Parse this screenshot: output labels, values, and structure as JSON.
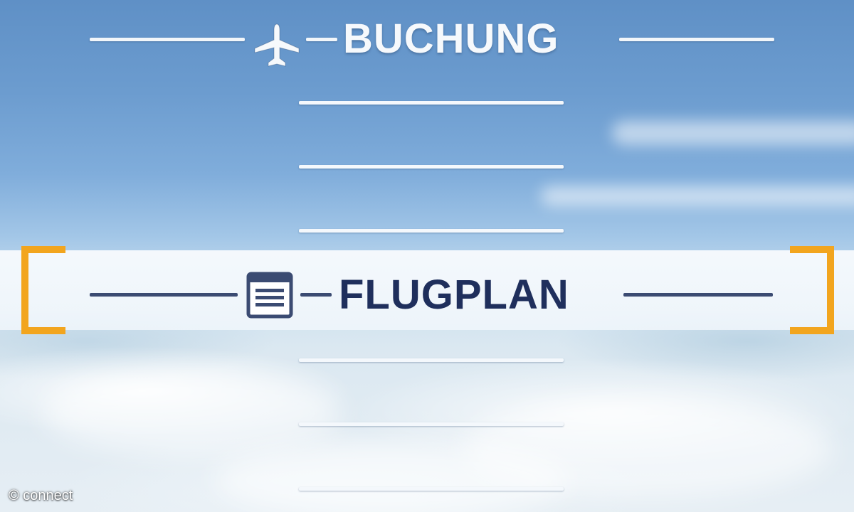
{
  "menu": {
    "header": {
      "label": "BUCHUNG",
      "icon": "airplane-icon"
    },
    "selected": {
      "label": "FLUGPLAN",
      "icon": "schedule-icon"
    },
    "empty_items_above": 3,
    "empty_items_below": 3
  },
  "watermark": {
    "text": "© connect"
  },
  "colors": {
    "accent": "#f2a51e",
    "selected_text": "#1f2f5c",
    "menu_line": "#f4f8fc",
    "sky_top": "#5f90c6"
  }
}
